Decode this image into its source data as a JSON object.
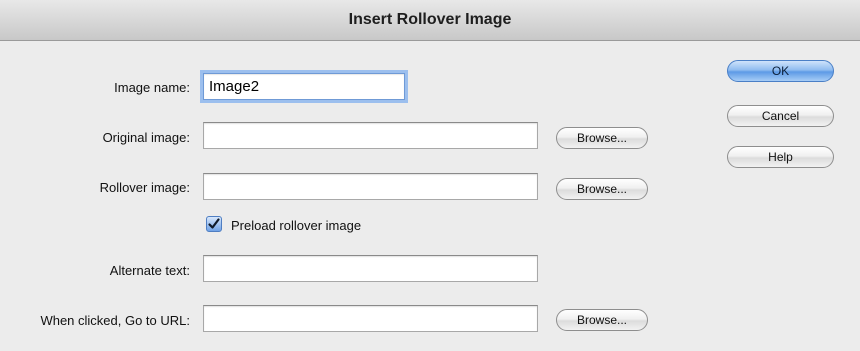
{
  "dialog": {
    "title": "Insert Rollover Image"
  },
  "form": {
    "image_name": {
      "label": "Image name:",
      "value": "Image2"
    },
    "original_image": {
      "label": "Original image:",
      "value": "",
      "browse_label": "Browse..."
    },
    "rollover_image": {
      "label": "Rollover image:",
      "value": "",
      "browse_label": "Browse..."
    },
    "preload": {
      "label": "Preload rollover image",
      "checked": true
    },
    "alternate_text": {
      "label": "Alternate text:",
      "value": ""
    },
    "go_to_url": {
      "label": "When clicked, Go to URL:",
      "value": "",
      "browse_label": "Browse..."
    }
  },
  "buttons": {
    "ok_label": "OK",
    "cancel_label": "Cancel",
    "help_label": "Help"
  },
  "colors": {
    "default_button": "#5d9ae6",
    "focus_ring": "#9cbfee",
    "checkbox": "#6fa2e6"
  },
  "icons": {
    "checkbox": "checkmark-icon"
  }
}
